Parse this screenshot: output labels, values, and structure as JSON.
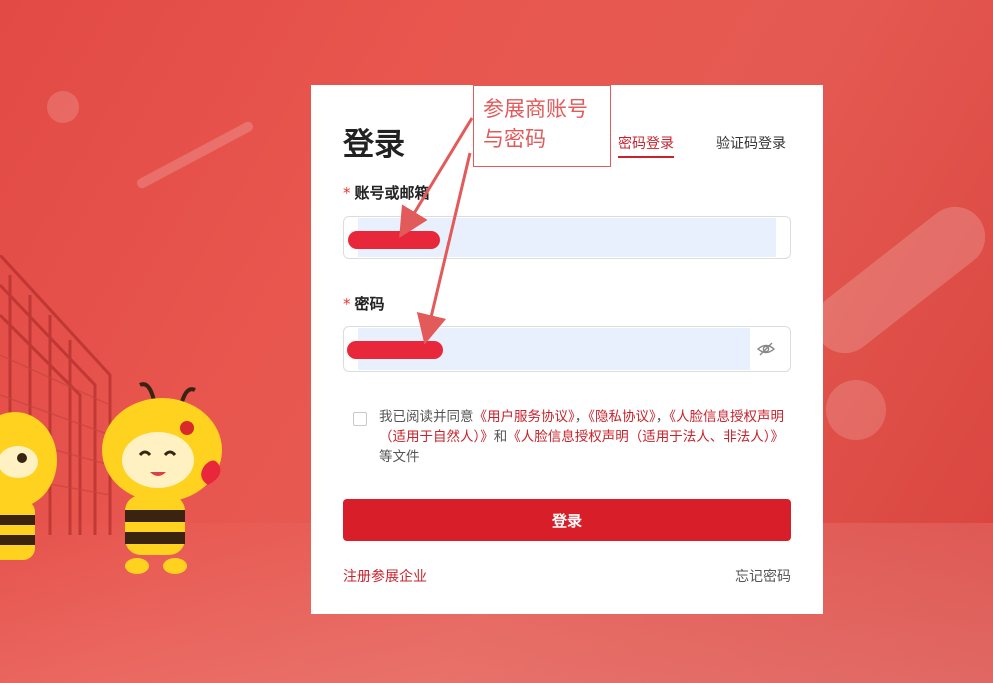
{
  "login": {
    "title": "登录",
    "tabs": [
      {
        "label": "密码登录",
        "active": true
      },
      {
        "label": "验证码登录",
        "active": false
      }
    ],
    "account": {
      "label": "账号或邮箱",
      "required_mark": "*",
      "value": ""
    },
    "password": {
      "label": "密码",
      "required_mark": "*",
      "value": ""
    },
    "agreement": {
      "checked": false,
      "prefix": "我已阅读并同意",
      "link_service": "《用户服务协议》",
      "sep1": "，",
      "link_privacy": "《隐私协议》",
      "sep2": "，",
      "link_face_natural": "《人脸信息授权声明（适用于自然人）》",
      "and": "和",
      "link_face_legal": "《人脸信息授权声明（适用于法人、非法人）》",
      "suffix": "等文件"
    },
    "submit_label": "登录",
    "register_label": "注册参展企业",
    "forgot_label": "忘记密码"
  },
  "annotation": {
    "text": "参展商账号与密码",
    "color": "#e35a5a"
  },
  "colors": {
    "brand_red": "#d81e28",
    "link_red": "#c8232c",
    "autofill_blue": "#e8f0fe"
  },
  "icons": {
    "password_toggle": "eye-slash-icon"
  }
}
